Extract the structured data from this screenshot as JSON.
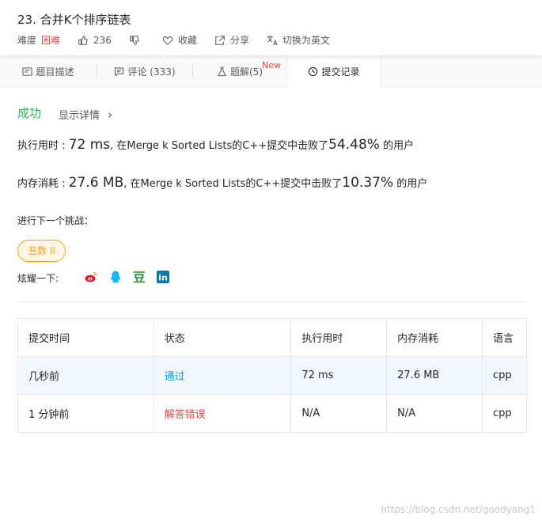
{
  "problem": {
    "title": "23. 合并K个排序链表",
    "difficulty_label": "难度",
    "difficulty": "困难",
    "likes": "236",
    "favorite_label": "收藏",
    "share_label": "分享",
    "switch_lang_label": "切换为英文",
    "icons": [
      "thumbs-up-icon",
      "thumbs-down-icon",
      "heart-icon",
      "share-icon",
      "translate-icon"
    ]
  },
  "tabs": [
    {
      "label": "题目描述",
      "icon": "description-icon"
    },
    {
      "label": "评论 (333)",
      "icon": "comment-icon"
    },
    {
      "label": "题解(5)",
      "icon": "flask-icon",
      "badge": "New"
    },
    {
      "label": "提交记录",
      "icon": "clock-icon",
      "active": true
    }
  ],
  "result": {
    "status": "成功",
    "details_link": "显示详情",
    "details_arrow": "›",
    "runtime_label": "执行用时 : ",
    "runtime_value": "72 ms",
    "runtime_text": ", 在Merge k Sorted Lists的C++提交中击败了",
    "runtime_percent": "54.48%",
    "runtime_suffix": " 的用户",
    "memory_label": "内存消耗 : ",
    "memory_value": "27.6 MB",
    "memory_text": ", 在Merge k Sorted Lists的C++提交中击败了",
    "memory_percent": "10.37%",
    "memory_suffix": " 的用户"
  },
  "next": {
    "label": "进行下一个挑战：",
    "challenge": "丑数 II"
  },
  "share": {
    "label": "炫耀一下:",
    "icons": [
      "weibo-icon",
      "qq-icon",
      "douban-icon",
      "linkedin-icon"
    ],
    "douban_glyph": "豆",
    "linkedin_glyph": "in"
  },
  "table": {
    "headers": [
      "提交时间",
      "状态",
      "执行用时",
      "内存消耗",
      "语言"
    ],
    "rows": [
      {
        "time": "几秒前",
        "status": "通过",
        "runtime": "72 ms",
        "memory": "27.6 MB",
        "lang": "cpp"
      },
      {
        "time": "1 分钟前",
        "status": "解答错误",
        "runtime": "N/A",
        "memory": "N/A",
        "lang": "cpp"
      }
    ]
  },
  "watermark": "https://blog.csdn.net/goodyang1",
  "colors": {
    "difficulty_hard": "#ef4743",
    "success": "#2db55d",
    "accepted": "#1c9ad6",
    "wrong_answer": "#ef4743",
    "challenge_orange": "#ffa116",
    "highlight_row": "#f0f8fe"
  }
}
